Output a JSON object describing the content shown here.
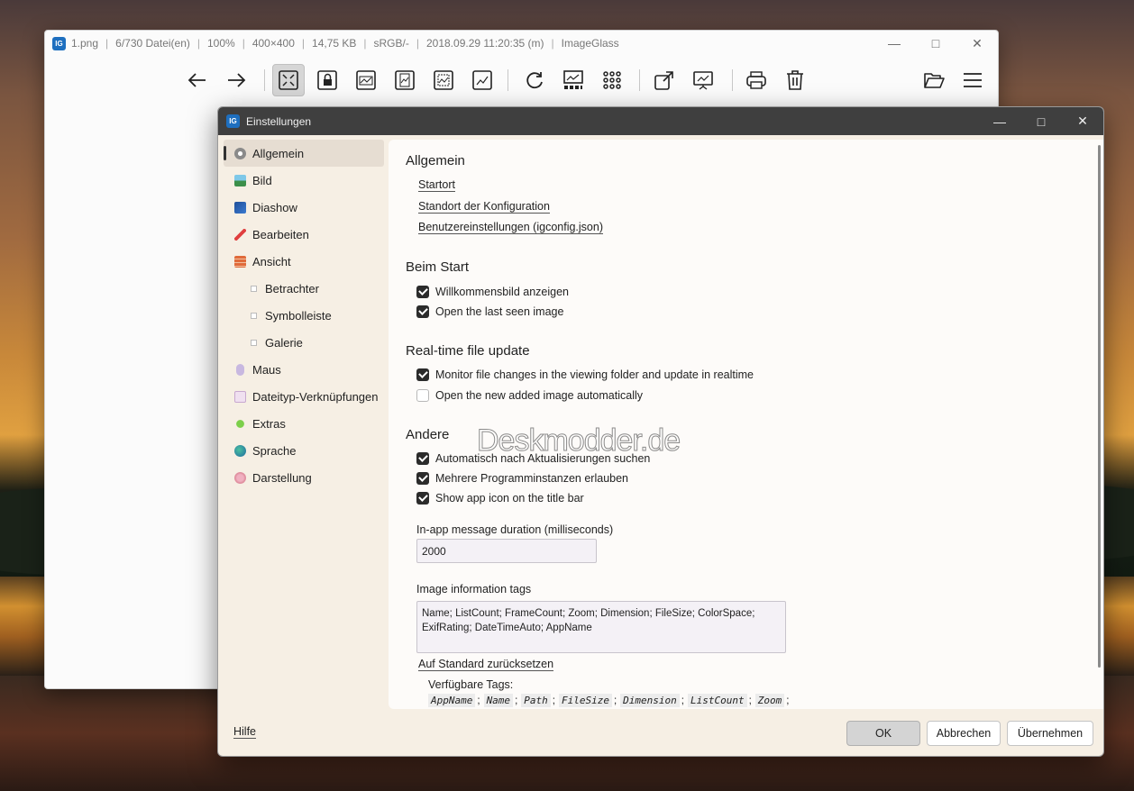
{
  "main_window": {
    "filename": "1.png",
    "list_count": "6/730 Datei(en)",
    "zoom": "100%",
    "dimension": "400×400",
    "file_size": "14,75 KB",
    "color_space": "sRGB/-",
    "datetime": "2018.09.29 11:20:35 (m)",
    "app_name": "ImageGlass",
    "logo_text": "IG"
  },
  "watermark": "Deskmodder.de",
  "dialog": {
    "title": "Einstellungen",
    "sidebar": [
      {
        "label": "Allgemein",
        "icon": "gear-icon",
        "color": "#8a8a8a"
      },
      {
        "label": "Bild",
        "icon": "image-icon",
        "color": "#3c8f4a"
      },
      {
        "label": "Diashow",
        "icon": "slideshow-icon",
        "color": "#1f4f9a"
      },
      {
        "label": "Bearbeiten",
        "icon": "pencil-icon",
        "color": "#e04040"
      },
      {
        "label": "Ansicht",
        "icon": "brick-icon",
        "color": "#e06a3a"
      },
      {
        "label": "Betrachter",
        "icon": "sub-item-icon"
      },
      {
        "label": "Symbolleiste",
        "icon": "sub-item-icon"
      },
      {
        "label": "Galerie",
        "icon": "sub-item-icon"
      },
      {
        "label": "Maus",
        "icon": "mouse-icon",
        "color": "#b0a0c8"
      },
      {
        "label": "Dateityp-Verknüpfungen",
        "icon": "file-icon",
        "color": "#d0a8d8"
      },
      {
        "label": "Extras",
        "icon": "puzzle-icon",
        "color": "#7ccf4a"
      },
      {
        "label": "Sprache",
        "icon": "globe-icon",
        "color": "#2a8a8a"
      },
      {
        "label": "Darstellung",
        "icon": "brain-icon",
        "color": "#e090a0"
      }
    ],
    "general": {
      "title": "Allgemein",
      "links": [
        "Startort",
        "Standort der Konfiguration",
        "Benutzereinstellungen (igconfig.json)"
      ]
    },
    "startup": {
      "title": "Beim Start",
      "options": [
        {
          "label": "Willkommensbild anzeigen",
          "checked": true
        },
        {
          "label": "Open the last seen image",
          "checked": true
        }
      ]
    },
    "realtime": {
      "title": "Real-time file update",
      "options": [
        {
          "label": "Monitor file changes in the viewing folder and update in realtime",
          "checked": true
        },
        {
          "label": "Open the new added image automatically",
          "checked": false
        }
      ]
    },
    "other": {
      "title": "Andere",
      "options": [
        {
          "label": "Automatisch nach Aktualisierungen suchen",
          "checked": true
        },
        {
          "label": "Mehrere Programminstanzen erlauben",
          "checked": true
        },
        {
          "label": "Show app icon on the title bar",
          "checked": true
        }
      ],
      "duration_label": "In-app message duration (milliseconds)",
      "duration_value": "2000",
      "tags_label": "Image information tags",
      "tags_line1": "Name; ListCount; FrameCount; Zoom; Dimension; FileSize; ColorSpace;",
      "tags_line2": "ExifRating; DateTimeAuto; AppName",
      "reset_link": "Auf Standard zurücksetzen",
      "available_label": "Verfügbare Tags:",
      "available_tags": [
        "AppName",
        "Name",
        "Path",
        "FileSize",
        "Dimension",
        "ListCount",
        "Zoom"
      ]
    },
    "footer": {
      "help": "Hilfe",
      "ok": "OK",
      "cancel": "Abbrechen",
      "apply": "Übernehmen"
    }
  }
}
